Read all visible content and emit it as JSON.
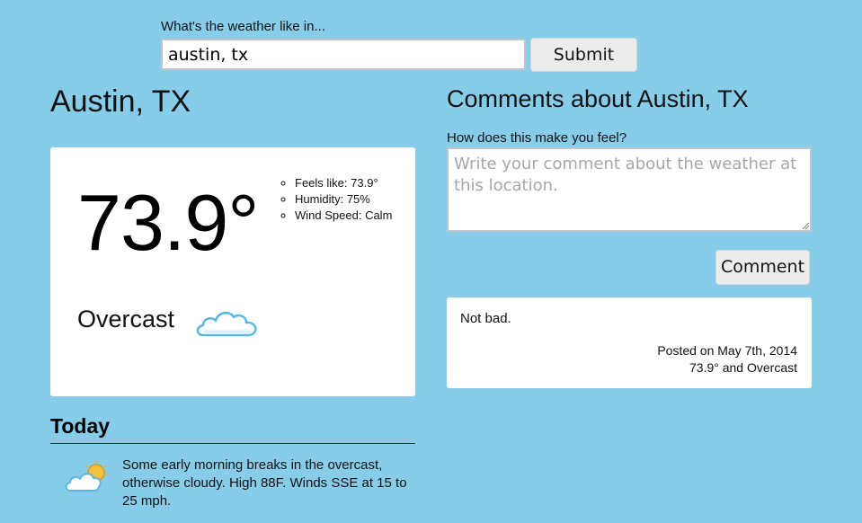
{
  "search": {
    "label": "What's the weather like in...",
    "value": "austin, tx",
    "submit_label": "Submit"
  },
  "location": {
    "title": "Austin, TX"
  },
  "current": {
    "temperature": "73.9°",
    "stats": [
      {
        "label": "Feels like:",
        "value": "73.9°"
      },
      {
        "label": "Humidity:",
        "value": "75%"
      },
      {
        "label": "Wind Speed:",
        "value": "Calm"
      }
    ],
    "condition": "Overcast",
    "condition_icon": "cloud-icon"
  },
  "today": {
    "title": "Today",
    "icon": "partly-cloudy-icon",
    "forecast": "Some early morning breaks in the overcast, otherwise cloudy. High 88F. Winds SSE at 15 to 25 mph."
  },
  "comments": {
    "title": "Comments about Austin, TX",
    "prompt": "How does this make you feel?",
    "placeholder": "Write your comment about the weather at this location.",
    "button_label": "Comment",
    "items": [
      {
        "text": "Not bad.",
        "posted": "Posted on May 7th, 2014",
        "conditions": "73.9° and Overcast"
      }
    ]
  },
  "colors": {
    "background": "#87cdea",
    "card": "#ffffff",
    "button": "#ececec"
  }
}
